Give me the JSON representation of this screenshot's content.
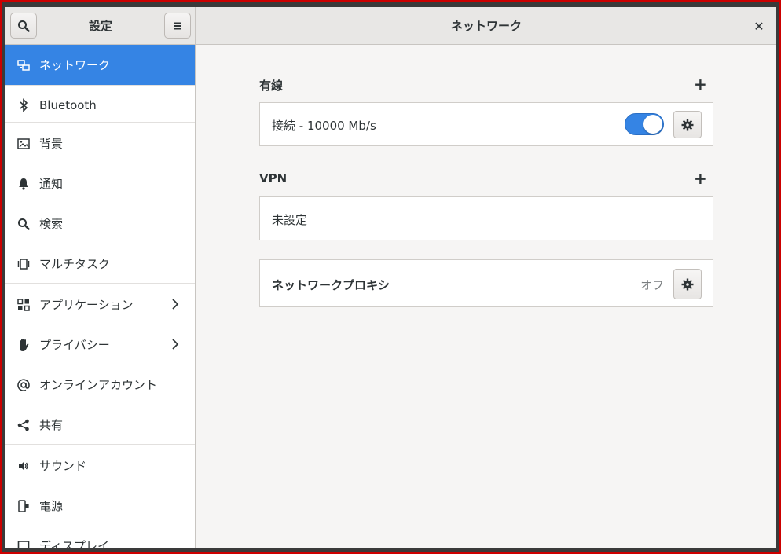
{
  "header": {
    "left_title": "設定",
    "right_title": "ネットワーク",
    "close_glyph": "✕"
  },
  "sidebar": {
    "items": [
      {
        "label": "ネットワーク",
        "icon": "network-icon"
      },
      {
        "label": "Bluetooth",
        "icon": "bluetooth-icon"
      },
      {
        "label": "背景",
        "icon": "background-icon"
      },
      {
        "label": "通知",
        "icon": "bell-icon"
      },
      {
        "label": "検索",
        "icon": "search-icon"
      },
      {
        "label": "マルチタスク",
        "icon": "multitask-icon"
      },
      {
        "label": "アプリケーション",
        "icon": "apps-grid-icon"
      },
      {
        "label": "プライバシー",
        "icon": "hand-icon"
      },
      {
        "label": "オンラインアカウント",
        "icon": "at-icon"
      },
      {
        "label": "共有",
        "icon": "share-icon"
      },
      {
        "label": "サウンド",
        "icon": "speaker-icon"
      },
      {
        "label": "電源",
        "icon": "power-plug-icon"
      },
      {
        "label": "ディスプレイ",
        "icon": "display-icon"
      }
    ]
  },
  "main": {
    "wired": {
      "title": "有線",
      "connection_label": "接続 - 10000 Mb/s",
      "toggle_on": true
    },
    "vpn": {
      "title": "VPN",
      "status": "未設定"
    },
    "proxy": {
      "label": "ネットワークプロキシ",
      "status": "オフ"
    }
  },
  "colors": {
    "accent": "#3584e4",
    "frame_border": "#cc0000"
  }
}
